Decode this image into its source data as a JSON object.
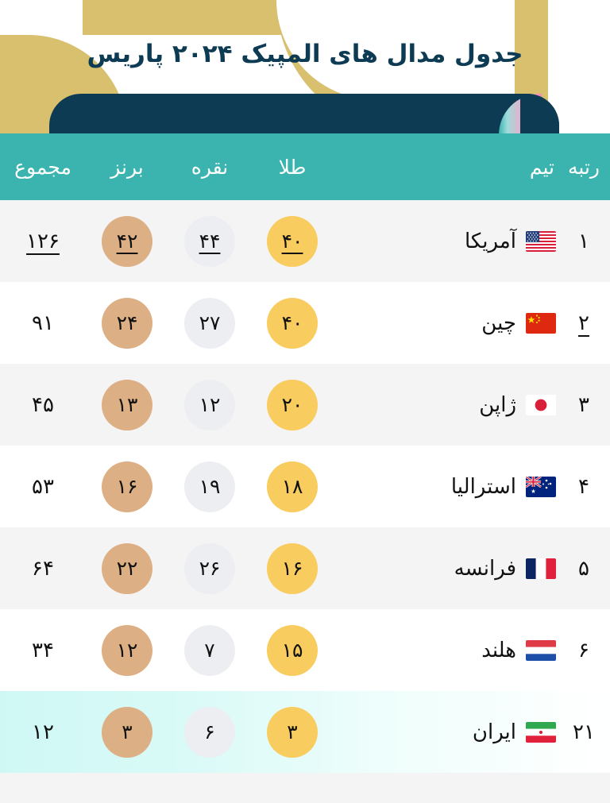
{
  "banner": {
    "title": "جدول مدال های المپیک ۲۰۲۴ پاریس",
    "colors": {
      "tan": "#D8C06F",
      "navy": "#0D3B54",
      "teal": "#3BB3AF",
      "pink": "#F58BB8",
      "white": "#FFFFFF"
    }
  },
  "table": {
    "headers": {
      "rank": "رتبه",
      "team": "تیم",
      "gold": "طلا",
      "silver": "نقره",
      "bronze": "برنز",
      "total": "مجموع"
    },
    "header_bg": "#3BB3AF",
    "medal_colors": {
      "gold": "#F8CC5E",
      "silver": "#EDEEF2",
      "bronze": "#DDAF84"
    },
    "highlight_row_color": "#CFF8F5",
    "rows": [
      {
        "rank": "۱",
        "team": "آمریکا",
        "flag": "flag-us-icon",
        "gold": "۴۰",
        "silver": "۴۴",
        "bronze": "۴۲",
        "total": "۱۲۶",
        "highlight": false
      },
      {
        "rank": "۲",
        "team": "چین",
        "flag": "flag-cn-icon",
        "gold": "۴۰",
        "silver": "۲۷",
        "bronze": "۲۴",
        "total": "۹۱",
        "highlight": false
      },
      {
        "rank": "۳",
        "team": "ژاپن",
        "flag": "flag-jp-icon",
        "gold": "۲۰",
        "silver": "۱۲",
        "bronze": "۱۳",
        "total": "۴۵",
        "highlight": false
      },
      {
        "rank": "۴",
        "team": "استرالیا",
        "flag": "flag-au-icon",
        "gold": "۱۸",
        "silver": "۱۹",
        "bronze": "۱۶",
        "total": "۵۳",
        "highlight": false
      },
      {
        "rank": "۵",
        "team": "فرانسه",
        "flag": "flag-fr-icon",
        "gold": "۱۶",
        "silver": "۲۶",
        "bronze": "۲۲",
        "total": "۶۴",
        "highlight": false
      },
      {
        "rank": "۶",
        "team": "هلند",
        "flag": "flag-nl-icon",
        "gold": "۱۵",
        "silver": "۷",
        "bronze": "۱۲",
        "total": "۳۴",
        "highlight": false
      },
      {
        "rank": "۲۱",
        "team": "ایران",
        "flag": "flag-ir-icon",
        "gold": "۳",
        "silver": "۶",
        "bronze": "۳",
        "total": "۱۲",
        "highlight": true
      }
    ]
  }
}
